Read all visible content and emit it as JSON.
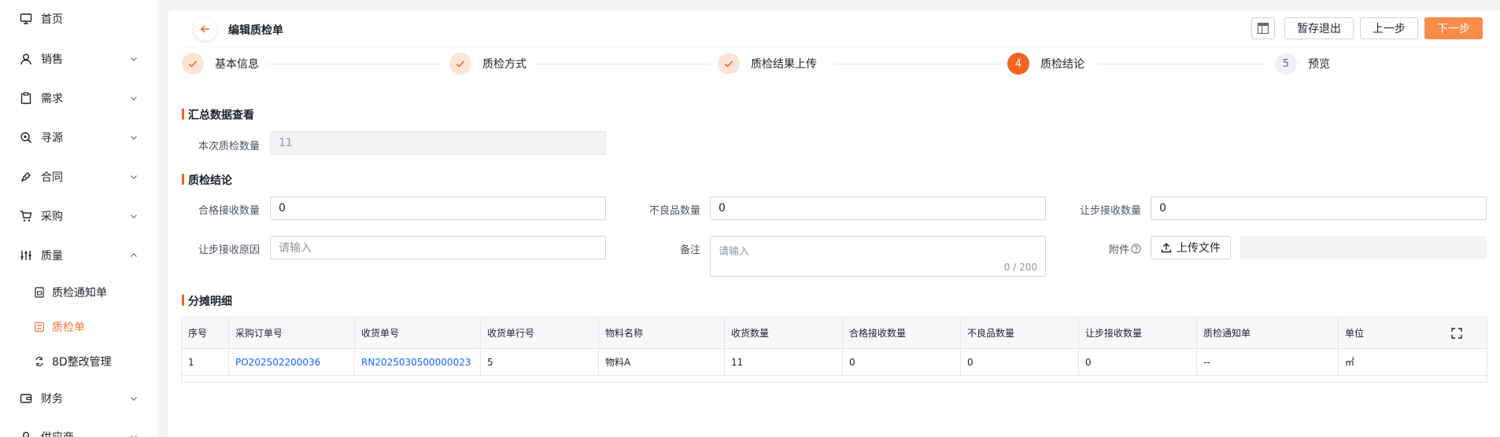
{
  "sidebar": {
    "items": [
      {
        "label": "首页",
        "icon": "monitor-icon",
        "expandable": false
      },
      {
        "label": "销售",
        "icon": "user-icon",
        "expandable": true
      },
      {
        "label": "需求",
        "icon": "clipboard-icon",
        "expandable": true
      },
      {
        "label": "寻源",
        "icon": "search-target-icon",
        "expandable": true
      },
      {
        "label": "合同",
        "icon": "pen-icon",
        "expandable": true
      },
      {
        "label": "采购",
        "icon": "cart-icon",
        "expandable": true
      },
      {
        "label": "质量",
        "icon": "sliders-icon",
        "expandable": true,
        "expanded": true
      },
      {
        "label": "财务",
        "icon": "wallet-icon",
        "expandable": true
      },
      {
        "label": "供应商",
        "icon": "person-icon",
        "expandable": true
      }
    ],
    "quality_sub": [
      {
        "label": "质检通知单",
        "icon": "document-icon",
        "active": false
      },
      {
        "label": "质检单",
        "icon": "check-list-icon",
        "active": true
      },
      {
        "label": "8D整改管理",
        "icon": "cycle-icon",
        "active": false
      }
    ],
    "accent_color": "#f5743a"
  },
  "header": {
    "title": "编辑质检单",
    "buttons": {
      "save_exit": "暂存退出",
      "prev": "上一步",
      "next": "下一步"
    },
    "primary_color": "#f98b4b"
  },
  "steps": [
    {
      "label": "基本信息",
      "status": "done",
      "number": ""
    },
    {
      "label": "质检方式",
      "status": "done",
      "number": ""
    },
    {
      "label": "质检结果上传",
      "status": "done",
      "number": ""
    },
    {
      "label": "质检结论",
      "status": "current",
      "number": "4"
    },
    {
      "label": "预览",
      "status": "todo",
      "number": "5"
    }
  ],
  "summary": {
    "section_title": "汇总数据查看",
    "qty_label": "本次质检数量",
    "qty_value": "11"
  },
  "conclusion": {
    "section_title": "质检结论",
    "accepted_label": "合格接收数量",
    "accepted_value": "0",
    "defect_label": "不良品数量",
    "defect_value": "0",
    "concession_label": "让步接收数量",
    "concession_value": "0",
    "reason_label": "让步接收原因",
    "reason_placeholder": "请输入",
    "remark_label": "备注",
    "remark_placeholder": "请输入",
    "remark_count": "0 / 200",
    "attachment_label": "附件",
    "upload_label": "上传文件"
  },
  "allocation": {
    "section_title": "分摊明细",
    "columns": [
      "序号",
      "采购订单号",
      "收货单号",
      "收货单行号",
      "物料名称",
      "收货数量",
      "合格接收数量",
      "不良品数量",
      "让步接收数量",
      "质检通知单",
      "单位"
    ],
    "rows": [
      [
        "1",
        "PO202502200036",
        "RN2025030500000023",
        "5",
        "物料A",
        "11",
        "0",
        "0",
        "0",
        "--",
        "㎡"
      ]
    ]
  }
}
